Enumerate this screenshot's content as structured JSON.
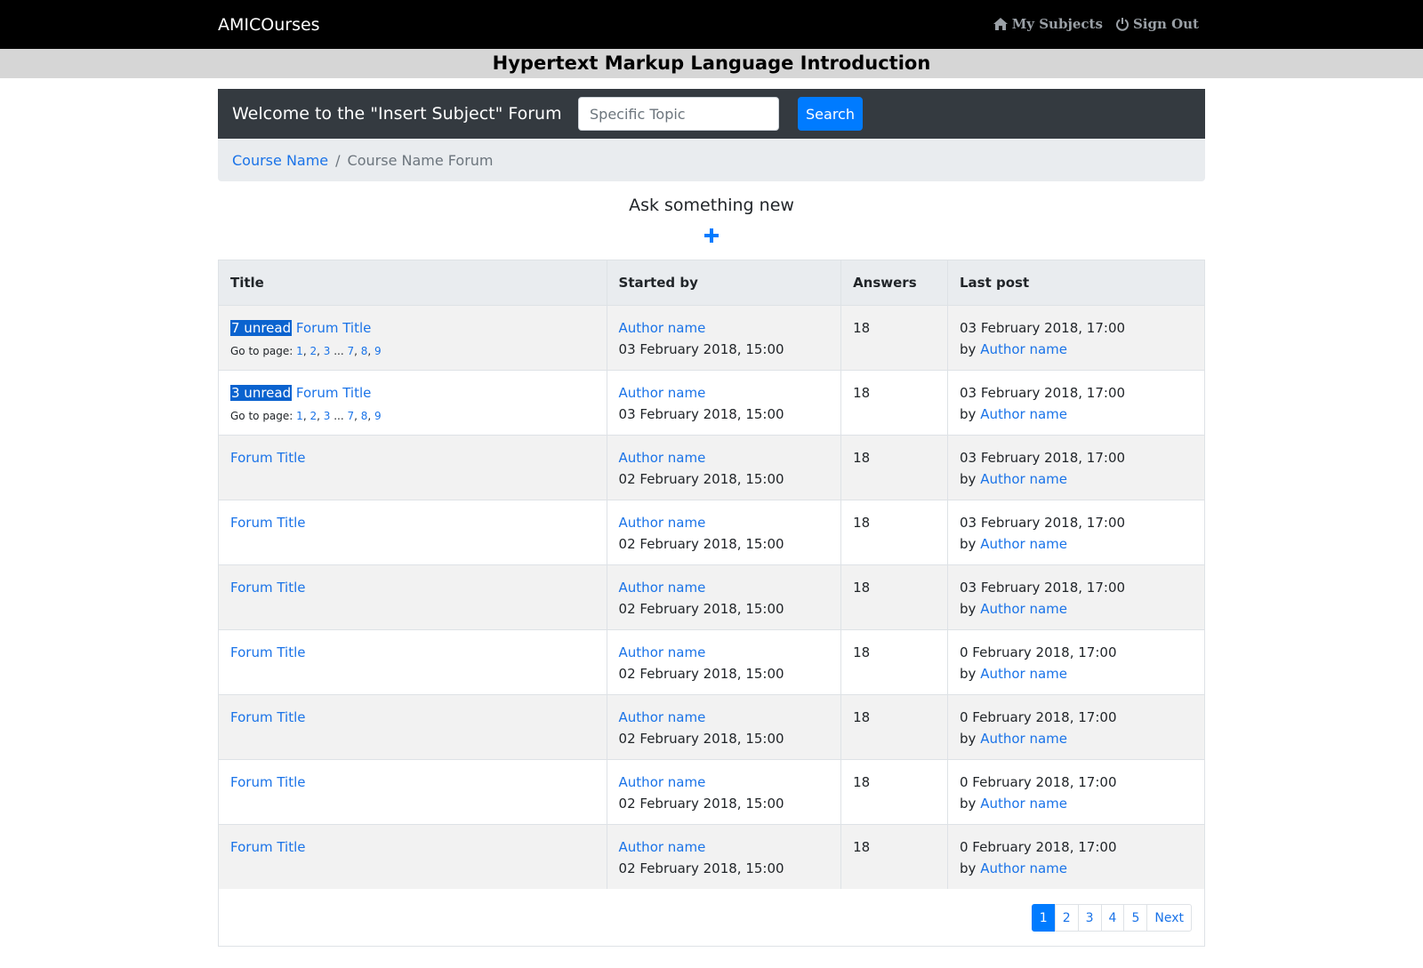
{
  "navbar": {
    "brand": "AMICOurses",
    "my_subjects": "My Subjects",
    "sign_out": "Sign Out",
    "icons": [
      "home-icon",
      "power-icon"
    ]
  },
  "banner": {
    "title": "Hypertext Markup Language Introduction"
  },
  "forum": {
    "welcome": "Welcome to the \"Insert Subject\" Forum",
    "search_placeholder": "Specific Topic",
    "search_label": "Search"
  },
  "breadcrumb": {
    "course": "Course Name",
    "separator": "/",
    "current": "Course Name Forum"
  },
  "ask": {
    "label": "Ask something new",
    "icon": "plus-icon"
  },
  "table": {
    "headers": {
      "title": "Title",
      "started_by": "Started by",
      "answers": "Answers",
      "last_post": "Last post"
    },
    "goto_label": "Go to page:",
    "goto_pages": [
      "1",
      "2",
      "3",
      "...",
      "7",
      "8",
      "9"
    ],
    "by_label": "by",
    "rows": [
      {
        "unread": "7 unread",
        "title": "Forum Title",
        "author": "Author name",
        "started": "03 February 2018, 15:00",
        "answers": "18",
        "last_date": "03 February 2018, 17:00",
        "last_author": "Author name"
      },
      {
        "unread": "3 unread",
        "title": "Forum Title",
        "author": "Author name",
        "started": "03 February 2018, 15:00",
        "answers": "18",
        "last_date": "03 February 2018, 17:00",
        "last_author": "Author name"
      },
      {
        "unread": "",
        "title": "Forum Title",
        "author": "Author name",
        "started": "02 February 2018, 15:00",
        "answers": "18",
        "last_date": "03 February 2018, 17:00",
        "last_author": "Author name"
      },
      {
        "unread": "",
        "title": "Forum Title",
        "author": "Author name",
        "started": "02 February 2018, 15:00",
        "answers": "18",
        "last_date": "03 February 2018, 17:00",
        "last_author": "Author name"
      },
      {
        "unread": "",
        "title": "Forum Title",
        "author": "Author name",
        "started": "02 February 2018, 15:00",
        "answers": "18",
        "last_date": "03 February 2018, 17:00",
        "last_author": "Author name"
      },
      {
        "unread": "",
        "title": "Forum Title",
        "author": "Author name",
        "started": "02 February 2018, 15:00",
        "answers": "18",
        "last_date": "0 February 2018, 17:00",
        "last_author": "Author name"
      },
      {
        "unread": "",
        "title": "Forum Title",
        "author": "Author name",
        "started": "02 February 2018, 15:00",
        "answers": "18",
        "last_date": "0 February 2018, 17:00",
        "last_author": "Author name"
      },
      {
        "unread": "",
        "title": "Forum Title",
        "author": "Author name",
        "started": "02 February 2018, 15:00",
        "answers": "18",
        "last_date": "0 February 2018, 17:00",
        "last_author": "Author name"
      },
      {
        "unread": "",
        "title": "Forum Title",
        "author": "Author name",
        "started": "02 February 2018, 15:00",
        "answers": "18",
        "last_date": "0 February 2018, 17:00",
        "last_author": "Author name"
      }
    ]
  },
  "pagination": {
    "pages": [
      "1",
      "2",
      "3",
      "4",
      "5"
    ],
    "next": "Next",
    "active": "1"
  },
  "colors": {
    "link": "#1a73e8",
    "primary": "#007bff",
    "navbar": "#000000",
    "header": "#343a40",
    "unread_bg": "#0b63cf"
  }
}
